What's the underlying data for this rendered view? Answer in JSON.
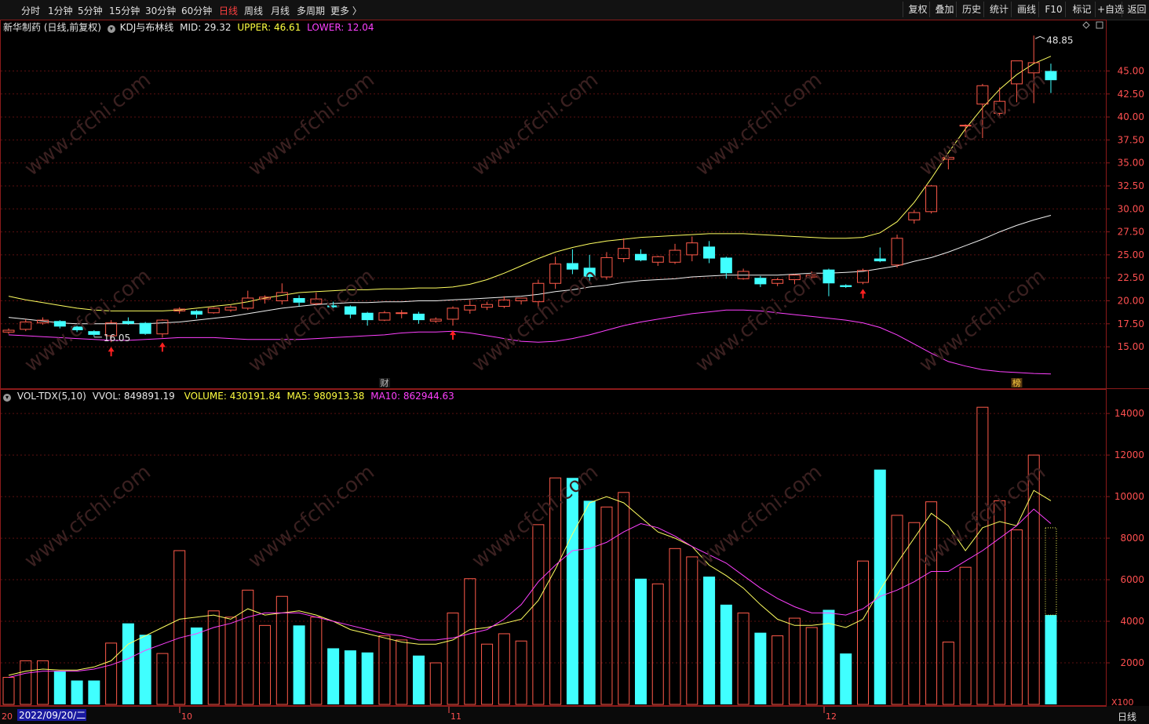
{
  "toolbar": {
    "periods": [
      "分时",
      "1分钟",
      "5分钟",
      "15分钟",
      "30分钟",
      "60分钟",
      "日线",
      "周线",
      "月线",
      "多周期",
      "更多 〉"
    ],
    "active_period": "日线",
    "right_buttons": [
      "复权",
      "叠加",
      "历史",
      "统计",
      "画线",
      "F10",
      "标记",
      "+自选",
      "返回"
    ]
  },
  "main": {
    "stock_name": "新华制药 (日线,前复权)",
    "indicator": "KDJ与布林线",
    "mid_label": "MID: 29.32",
    "upper_label": "UPPER: 46.61",
    "lower_label": "LOWER: 12.04",
    "high_marker": "48.85",
    "low_marker": "16.05",
    "event_markers": [
      "财",
      "榜"
    ],
    "price_axis": [
      "45.00",
      "42.50",
      "40.00",
      "37.50",
      "35.00",
      "32.50",
      "30.00",
      "27.50",
      "25.00",
      "22.50",
      "20.00",
      "17.50",
      "15.00"
    ]
  },
  "volume": {
    "indicator": "VOL-TDX(5,10)",
    "vvol": "VVOL: 849891.19",
    "volume": "VOLUME: 430191.84",
    "ma5": "MA5: 980913.38",
    "ma10": "MA10: 862944.63",
    "axis": [
      "14000",
      "12000",
      "10000",
      "8000",
      "6000",
      "4000",
      "2000"
    ],
    "unit": "X100"
  },
  "date_axis": {
    "cursor_date": "2022/09/20/二",
    "left_stub": "20",
    "month_labels": [
      "10",
      "11",
      "12"
    ],
    "period_label": "日线"
  },
  "chart_data": {
    "type": "candlestick",
    "price_ylim": [
      12.5,
      49.5
    ],
    "volume_ylim": [
      0,
      15000
    ],
    "candles": [
      {
        "o": 16.6,
        "h": 17.0,
        "l": 16.4,
        "c": 16.8,
        "v": 1300
      },
      {
        "o": 16.9,
        "h": 18.0,
        "l": 16.7,
        "c": 17.7,
        "v": 2100
      },
      {
        "o": 17.6,
        "h": 18.2,
        "l": 17.4,
        "c": 17.9,
        "v": 2100
      },
      {
        "o": 17.8,
        "h": 17.9,
        "l": 17.0,
        "c": 17.2,
        "v": 1600
      },
      {
        "o": 17.2,
        "h": 17.3,
        "l": 16.6,
        "c": 16.8,
        "v": 1150
      },
      {
        "o": 16.7,
        "h": 16.8,
        "l": 16.1,
        "c": 16.3,
        "v": 1150
      },
      {
        "o": 16.2,
        "h": 17.9,
        "l": 15.5,
        "c": 17.6,
        "v": 2950
      },
      {
        "o": 17.8,
        "h": 18.2,
        "l": 17.4,
        "c": 17.5,
        "v": 3900
      },
      {
        "o": 17.6,
        "h": 17.7,
        "l": 16.3,
        "c": 16.4,
        "v": 3350
      },
      {
        "o": 16.4,
        "h": 18.0,
        "l": 16.0,
        "c": 17.9,
        "v": 2450
      },
      {
        "o": 18.9,
        "h": 19.3,
        "l": 18.6,
        "c": 19.1,
        "v": 7400
      },
      {
        "o": 18.9,
        "h": 19.0,
        "l": 18.1,
        "c": 18.5,
        "v": 3700
      },
      {
        "o": 18.7,
        "h": 19.3,
        "l": 18.6,
        "c": 19.2,
        "v": 4500
      },
      {
        "o": 19.0,
        "h": 19.5,
        "l": 18.8,
        "c": 19.3,
        "v": 4200
      },
      {
        "o": 19.2,
        "h": 21.1,
        "l": 19.0,
        "c": 20.3,
        "v": 5500
      },
      {
        "o": 20.2,
        "h": 20.6,
        "l": 19.7,
        "c": 20.4,
        "v": 3800
      },
      {
        "o": 20.0,
        "h": 21.9,
        "l": 19.6,
        "c": 20.9,
        "v": 5200
      },
      {
        "o": 20.3,
        "h": 20.6,
        "l": 19.4,
        "c": 19.8,
        "v": 3800
      },
      {
        "o": 19.7,
        "h": 20.9,
        "l": 19.5,
        "c": 20.2,
        "v": 4200
      },
      {
        "o": 19.5,
        "h": 19.9,
        "l": 19.2,
        "c": 19.3,
        "v": 2700
      },
      {
        "o": 19.4,
        "h": 19.5,
        "l": 18.1,
        "c": 18.5,
        "v": 2600
      },
      {
        "o": 18.7,
        "h": 18.8,
        "l": 17.3,
        "c": 17.9,
        "v": 2500
      },
      {
        "o": 17.9,
        "h": 18.9,
        "l": 17.8,
        "c": 18.7,
        "v": 3300
      },
      {
        "o": 18.7,
        "h": 19.0,
        "l": 18.1,
        "c": 18.7,
        "v": 3100
      },
      {
        "o": 18.6,
        "h": 18.8,
        "l": 17.5,
        "c": 17.9,
        "v": 2350
      },
      {
        "o": 17.8,
        "h": 18.2,
        "l": 17.6,
        "c": 18.0,
        "v": 2000
      },
      {
        "o": 18.0,
        "h": 19.4,
        "l": 17.3,
        "c": 19.2,
        "v": 4400
      },
      {
        "o": 19.0,
        "h": 20.1,
        "l": 18.6,
        "c": 19.5,
        "v": 6050
      },
      {
        "o": 19.3,
        "h": 19.9,
        "l": 19.0,
        "c": 19.6,
        "v": 2900
      },
      {
        "o": 19.4,
        "h": 20.5,
        "l": 19.2,
        "c": 20.1,
        "v": 3400
      },
      {
        "o": 20.0,
        "h": 20.3,
        "l": 19.6,
        "c": 20.3,
        "v": 3050
      },
      {
        "o": 19.9,
        "h": 22.3,
        "l": 19.2,
        "c": 21.9,
        "v": 8650
      },
      {
        "o": 21.9,
        "h": 24.8,
        "l": 21.3,
        "c": 24.0,
        "v": 10900
      },
      {
        "o": 24.1,
        "h": 25.6,
        "l": 22.9,
        "c": 23.4,
        "v": 10900
      },
      {
        "o": 23.6,
        "h": 25.0,
        "l": 21.9,
        "c": 22.6,
        "v": 9800
      },
      {
        "o": 22.6,
        "h": 25.3,
        "l": 22.3,
        "c": 24.7,
        "v": 9500
      },
      {
        "o": 24.6,
        "h": 26.8,
        "l": 24.2,
        "c": 25.7,
        "v": 10200
      },
      {
        "o": 25.1,
        "h": 25.6,
        "l": 24.3,
        "c": 24.4,
        "v": 6050
      },
      {
        "o": 24.2,
        "h": 24.9,
        "l": 23.8,
        "c": 24.8,
        "v": 5800
      },
      {
        "o": 24.2,
        "h": 26.2,
        "l": 24.0,
        "c": 25.5,
        "v": 7500
      },
      {
        "o": 25.0,
        "h": 27.0,
        "l": 24.3,
        "c": 26.3,
        "v": 7100
      },
      {
        "o": 25.9,
        "h": 26.5,
        "l": 24.1,
        "c": 24.6,
        "v": 6150
      },
      {
        "o": 24.7,
        "h": 24.8,
        "l": 22.4,
        "c": 23.0,
        "v": 4800
      },
      {
        "o": 22.4,
        "h": 23.5,
        "l": 22.3,
        "c": 23.2,
        "v": 4400
      },
      {
        "o": 22.5,
        "h": 22.7,
        "l": 21.5,
        "c": 21.8,
        "v": 3450
      },
      {
        "o": 21.9,
        "h": 22.5,
        "l": 21.6,
        "c": 22.3,
        "v": 3300
      },
      {
        "o": 22.3,
        "h": 22.9,
        "l": 21.8,
        "c": 22.8,
        "v": 4150
      },
      {
        "o": 22.6,
        "h": 23.2,
        "l": 22.3,
        "c": 22.8,
        "v": 3700
      },
      {
        "o": 23.4,
        "h": 23.5,
        "l": 20.5,
        "c": 21.9,
        "v": 4550
      },
      {
        "o": 21.7,
        "h": 21.8,
        "l": 21.4,
        "c": 21.5,
        "v": 2450
      },
      {
        "o": 22.0,
        "h": 23.5,
        "l": 21.8,
        "c": 23.3,
        "v": 6900
      },
      {
        "o": 24.6,
        "h": 25.8,
        "l": 24.2,
        "c": 24.3,
        "v": 11300
      },
      {
        "o": 23.9,
        "h": 27.2,
        "l": 23.6,
        "c": 26.8,
        "v": 9100
      },
      {
        "o": 28.8,
        "h": 29.9,
        "l": 28.4,
        "c": 29.6,
        "v": 8750
      },
      {
        "o": 29.7,
        "h": 32.6,
        "l": 29.5,
        "c": 32.5,
        "v": 9750
      },
      {
        "o": 35.4,
        "h": 35.8,
        "l": 34.3,
        "c": 35.6,
        "v": 3000
      },
      {
        "o": 39.1,
        "h": 39.2,
        "l": 37.8,
        "c": 39.1,
        "v": 6600
      },
      {
        "o": 41.4,
        "h": 43.6,
        "l": 37.7,
        "c": 43.4,
        "v": 14300
      },
      {
        "o": 40.4,
        "h": 43.2,
        "l": 40.1,
        "c": 41.7,
        "v": 9800
      },
      {
        "o": 43.6,
        "h": 46.1,
        "l": 41.6,
        "c": 46.1,
        "v": 8400
      },
      {
        "o": 44.8,
        "h": 48.85,
        "l": 41.5,
        "c": 45.9,
        "v": 12000
      },
      {
        "o": 45.0,
        "h": 45.8,
        "l": 42.6,
        "c": 44.0,
        "v": 4300
      }
    ],
    "bollinger": {
      "mid": [
        18.2,
        18.0,
        17.8,
        17.6,
        17.5,
        17.5,
        17.5,
        17.5,
        17.5,
        17.6,
        17.7,
        17.9,
        18.1,
        18.3,
        18.6,
        18.9,
        19.2,
        19.4,
        19.6,
        19.7,
        19.8,
        19.8,
        19.9,
        19.9,
        20.0,
        20.0,
        20.1,
        20.2,
        20.3,
        20.4,
        20.5,
        20.7,
        21.0,
        21.2,
        21.5,
        21.7,
        22.0,
        22.2,
        22.3,
        22.4,
        22.6,
        22.7,
        22.8,
        22.8,
        22.8,
        22.8,
        22.9,
        23.0,
        23.0,
        23.1,
        23.2,
        23.5,
        23.8,
        24.3,
        24.7,
        25.3,
        26.0,
        26.7,
        27.5,
        28.2,
        28.8,
        29.3
      ],
      "upper": [
        20.5,
        20.1,
        19.8,
        19.5,
        19.2,
        19.0,
        18.9,
        18.9,
        18.9,
        18.9,
        19.0,
        19.2,
        19.4,
        19.6,
        19.9,
        20.3,
        20.6,
        20.9,
        21.0,
        21.1,
        21.2,
        21.2,
        21.3,
        21.3,
        21.4,
        21.4,
        21.5,
        21.8,
        22.3,
        23.0,
        23.8,
        24.6,
        25.3,
        25.8,
        26.2,
        26.5,
        26.7,
        26.9,
        27.0,
        27.1,
        27.2,
        27.3,
        27.3,
        27.3,
        27.2,
        27.1,
        27.0,
        26.9,
        26.8,
        26.8,
        26.9,
        27.4,
        28.6,
        30.7,
        33.3,
        36.1,
        38.7,
        41.0,
        43.0,
        44.6,
        45.8,
        46.6
      ],
      "lower": [
        16.3,
        16.2,
        16.1,
        16.0,
        15.9,
        15.8,
        15.7,
        15.7,
        15.8,
        15.9,
        16.0,
        16.0,
        16.0,
        15.9,
        15.8,
        15.8,
        15.8,
        15.8,
        15.9,
        16.0,
        16.1,
        16.2,
        16.3,
        16.5,
        16.6,
        16.6,
        16.7,
        16.5,
        16.2,
        15.9,
        15.6,
        15.5,
        15.6,
        15.9,
        16.3,
        16.8,
        17.3,
        17.7,
        18.0,
        18.3,
        18.6,
        18.8,
        19.0,
        19.0,
        18.9,
        18.7,
        18.5,
        18.3,
        18.1,
        17.9,
        17.6,
        17.1,
        16.3,
        15.3,
        14.3,
        13.4,
        12.9,
        12.5,
        12.3,
        12.2,
        12.1,
        12.04
      ]
    },
    "ma5": [
      1400,
      1600,
      1700,
      1650,
      1650,
      1800,
      2100,
      2900,
      3300,
      3700,
      4100,
      4200,
      4300,
      4100,
      4600,
      4300,
      4400,
      4500,
      4300,
      4000,
      3600,
      3400,
      3200,
      3000,
      2900,
      2900,
      3100,
      3600,
      3700,
      3900,
      4100,
      5000,
      6500,
      8200,
      9700,
      10000,
      9700,
      9000,
      8300,
      8000,
      7600,
      6700,
      6200,
      5600,
      4800,
      4100,
      3800,
      3800,
      3900,
      3700,
      4100,
      5500,
      6800,
      8000,
      9200,
      8600,
      7400,
      8500,
      8800,
      8600,
      10300,
      9800
    ],
    "ma10": [
      1300,
      1500,
      1600,
      1600,
      1600,
      1700,
      1900,
      2200,
      2600,
      2900,
      3200,
      3400,
      3700,
      3900,
      4200,
      4400,
      4400,
      4400,
      4200,
      4000,
      3800,
      3600,
      3400,
      3300,
      3100,
      3100,
      3200,
      3400,
      3600,
      4100,
      4800,
      5900,
      6700,
      7400,
      7500,
      7800,
      8300,
      8700,
      8500,
      8100,
      7600,
      7200,
      6800,
      6200,
      5600,
      5100,
      4700,
      4400,
      4400,
      4300,
      4600,
      5200,
      5500,
      5900,
      6400,
      6400,
      6900,
      7400,
      8000,
      8600,
      9400,
      8700
    ]
  }
}
